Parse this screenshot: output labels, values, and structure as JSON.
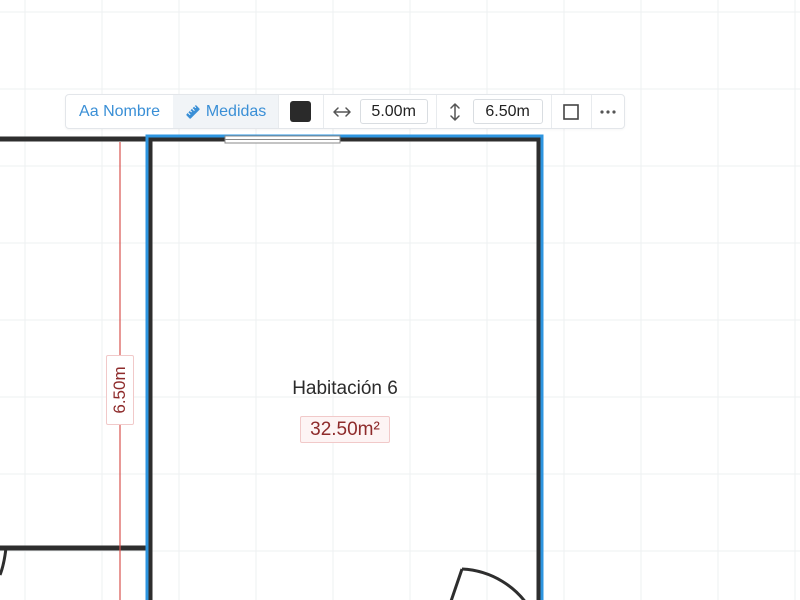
{
  "toolbar": {
    "name_label": "Aa Nombre",
    "measure_label": "Medidas",
    "color": "#2a2a2a",
    "width_value": "5.00m",
    "height_value": "6.50m"
  },
  "room": {
    "name": "Habitación 6",
    "area": "32.50m²",
    "dimension_label": "6.50m"
  },
  "colors": {
    "selection": "#2d95e0",
    "wall": "#2e2e2e",
    "grid": "#eef0f2",
    "dimension_line": "#d9534f",
    "accent": "#3a8fd6"
  }
}
